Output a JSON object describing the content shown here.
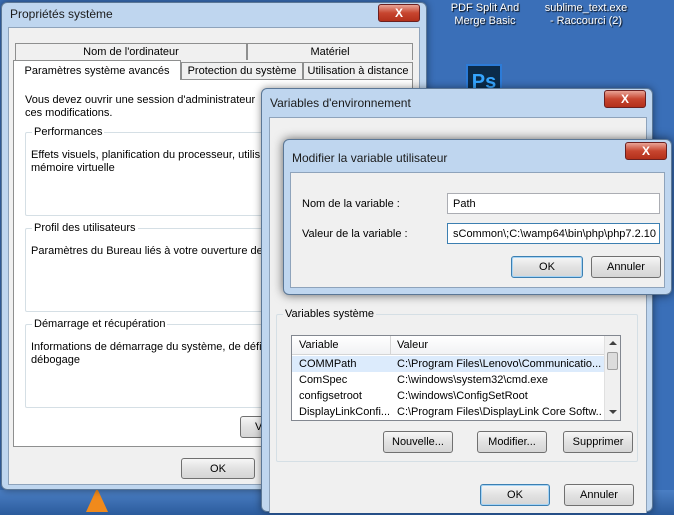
{
  "desktop": {
    "icon1_label": "PDF Split And\nMerge Basic",
    "icon2_label": "sublime_text.exe\n- Raccourci (2)",
    "ps_label": "Ps"
  },
  "sysprops": {
    "title": "Propriétés système",
    "close": "X",
    "tabs_row1": [
      "Nom de l'ordinateur",
      "Matériel"
    ],
    "tabs_row2": [
      "Paramètres système avancés",
      "Protection du système",
      "Utilisation à distance"
    ],
    "admin_note": "Vous devez ouvrir une session d'administrateur\nces modifications.",
    "perf_title": "Performances",
    "perf_desc": "Effets visuels, planification du processeur, utilis\nmémoire virtuelle",
    "profile_title": "Profil des utilisateurs",
    "profile_desc": "Paramètres du Bureau liés à votre ouverture de",
    "startup_title": "Démarrage et récupération",
    "startup_desc": "Informations de démarrage du système, de défi\ndébogage",
    "var_btn": "Var",
    "ok": "OK"
  },
  "envvars": {
    "title": "Variables d'environnement",
    "close": "X",
    "system_group": "Variables système",
    "col_variable": "Variable",
    "col_value": "Valeur",
    "rows": [
      {
        "name": "COMMPath",
        "value": "C:\\Program Files\\Lenovo\\Communicatio..."
      },
      {
        "name": "ComSpec",
        "value": "C:\\windows\\system32\\cmd.exe"
      },
      {
        "name": "configsetroot",
        "value": "C:\\windows\\ConfigSetRoot"
      },
      {
        "name": "DisplayLinkConfi...",
        "value": "C:\\Program Files\\DisplayLink Core Softw..."
      }
    ],
    "btn_new": "Nouvelle...",
    "btn_edit": "Modifier...",
    "btn_delete": "Supprimer",
    "ok": "OK",
    "cancel": "Annuler"
  },
  "editvar": {
    "title": "Modifier la variable utilisateur",
    "close": "X",
    "name_label": "Nom de la variable :",
    "name_value": "Path",
    "value_label": "Valeur de la variable :",
    "value_value": "sCommon\\;C:\\wamp64\\bin\\php\\php7.2.10",
    "ok": "OK",
    "cancel": "Annuler"
  },
  "colors": {
    "desktop": "#3a6fb8",
    "frame": "#bfd6ef",
    "close": "#c7452f"
  }
}
